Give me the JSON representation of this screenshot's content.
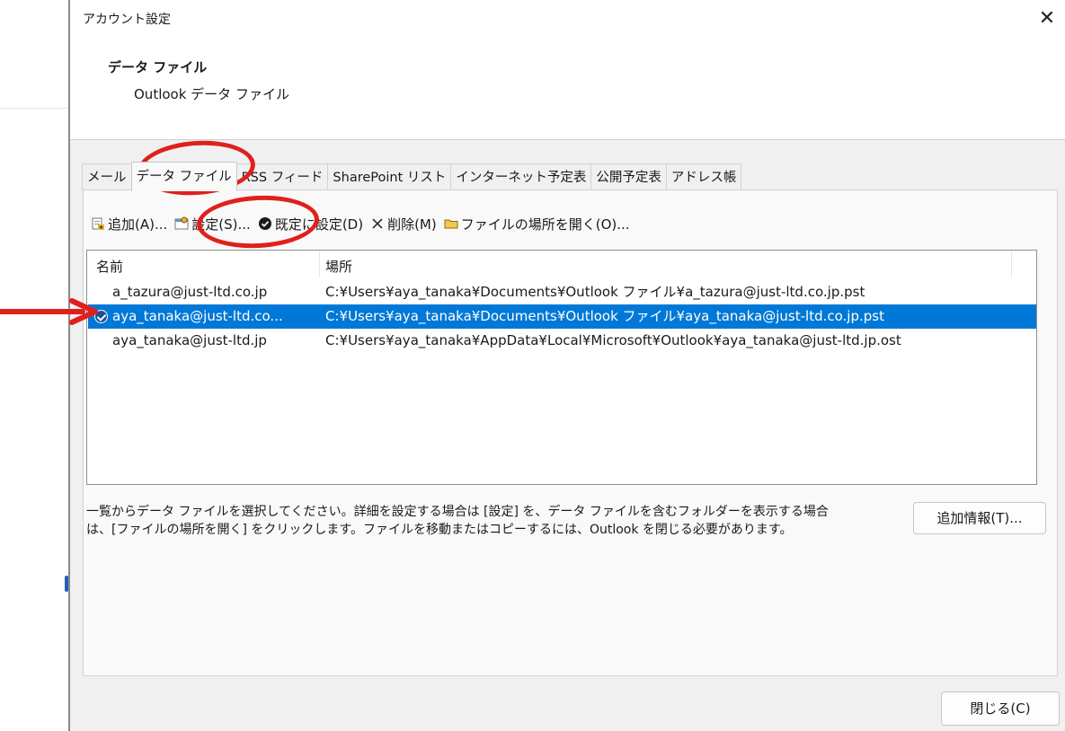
{
  "dialog": {
    "title": "アカウント設定",
    "close_glyph": "✕",
    "header_title": "データ ファイル",
    "header_subtitle": "Outlook データ ファイル"
  },
  "tabs": [
    {
      "label": "メール",
      "active": false
    },
    {
      "label": "データ ファイル",
      "active": true
    },
    {
      "label": "RSS フィード",
      "active": false
    },
    {
      "label": "SharePoint リスト",
      "active": false
    },
    {
      "label": "インターネット予定表",
      "active": false
    },
    {
      "label": "公開予定表",
      "active": false
    },
    {
      "label": "アドレス帳",
      "active": false
    }
  ],
  "toolbar": {
    "add": {
      "label": "追加(A)...",
      "icon": "add-file-icon"
    },
    "settings": {
      "label": "設定(S)...",
      "icon": "settings-icon"
    },
    "set_default": {
      "label": "既定に設定(D)",
      "icon": "checkmark-icon"
    },
    "remove": {
      "label": "削除(M)",
      "icon": "x-icon"
    },
    "open_location": {
      "label": "ファイルの場所を開く(O)...",
      "icon": "folder-icon"
    }
  },
  "list": {
    "columns": [
      "名前",
      "場所"
    ],
    "rows": [
      {
        "name": "a_tazura@just-ltd.co.jp",
        "location": "C:¥Users¥aya_tanaka¥Documents¥Outlook ファイル¥a_tazura@just-ltd.co.jp.pst",
        "default": false,
        "selected": false
      },
      {
        "name": "aya_tanaka@just-ltd.co...",
        "location": "C:¥Users¥aya_tanaka¥Documents¥Outlook ファイル¥aya_tanaka@just-ltd.co.jp.pst",
        "default": true,
        "selected": true
      },
      {
        "name": "aya_tanaka@just-ltd.jp",
        "location": "C:¥Users¥aya_tanaka¥AppData¥Local¥Microsoft¥Outlook¥aya_tanaka@just-ltd.jp.ost",
        "default": false,
        "selected": false
      }
    ]
  },
  "help_text_line1": "一覧からデータ ファイルを選択してください。詳細を設定する場合は [設定] を、データ ファイルを含むフォルダーを表示する場合",
  "help_text_line2": "は、[ファイルの場所を開く] をクリックします。ファイルを移動またはコピーするには、Outlook を閉じる必要があります。",
  "buttons": {
    "more_info": "追加情報(T)...",
    "close": "閉じる(C)"
  },
  "colors": {
    "selection": "#0078d7",
    "annotation": "#e0201c",
    "dialog_bg": "#f0f0f0"
  }
}
